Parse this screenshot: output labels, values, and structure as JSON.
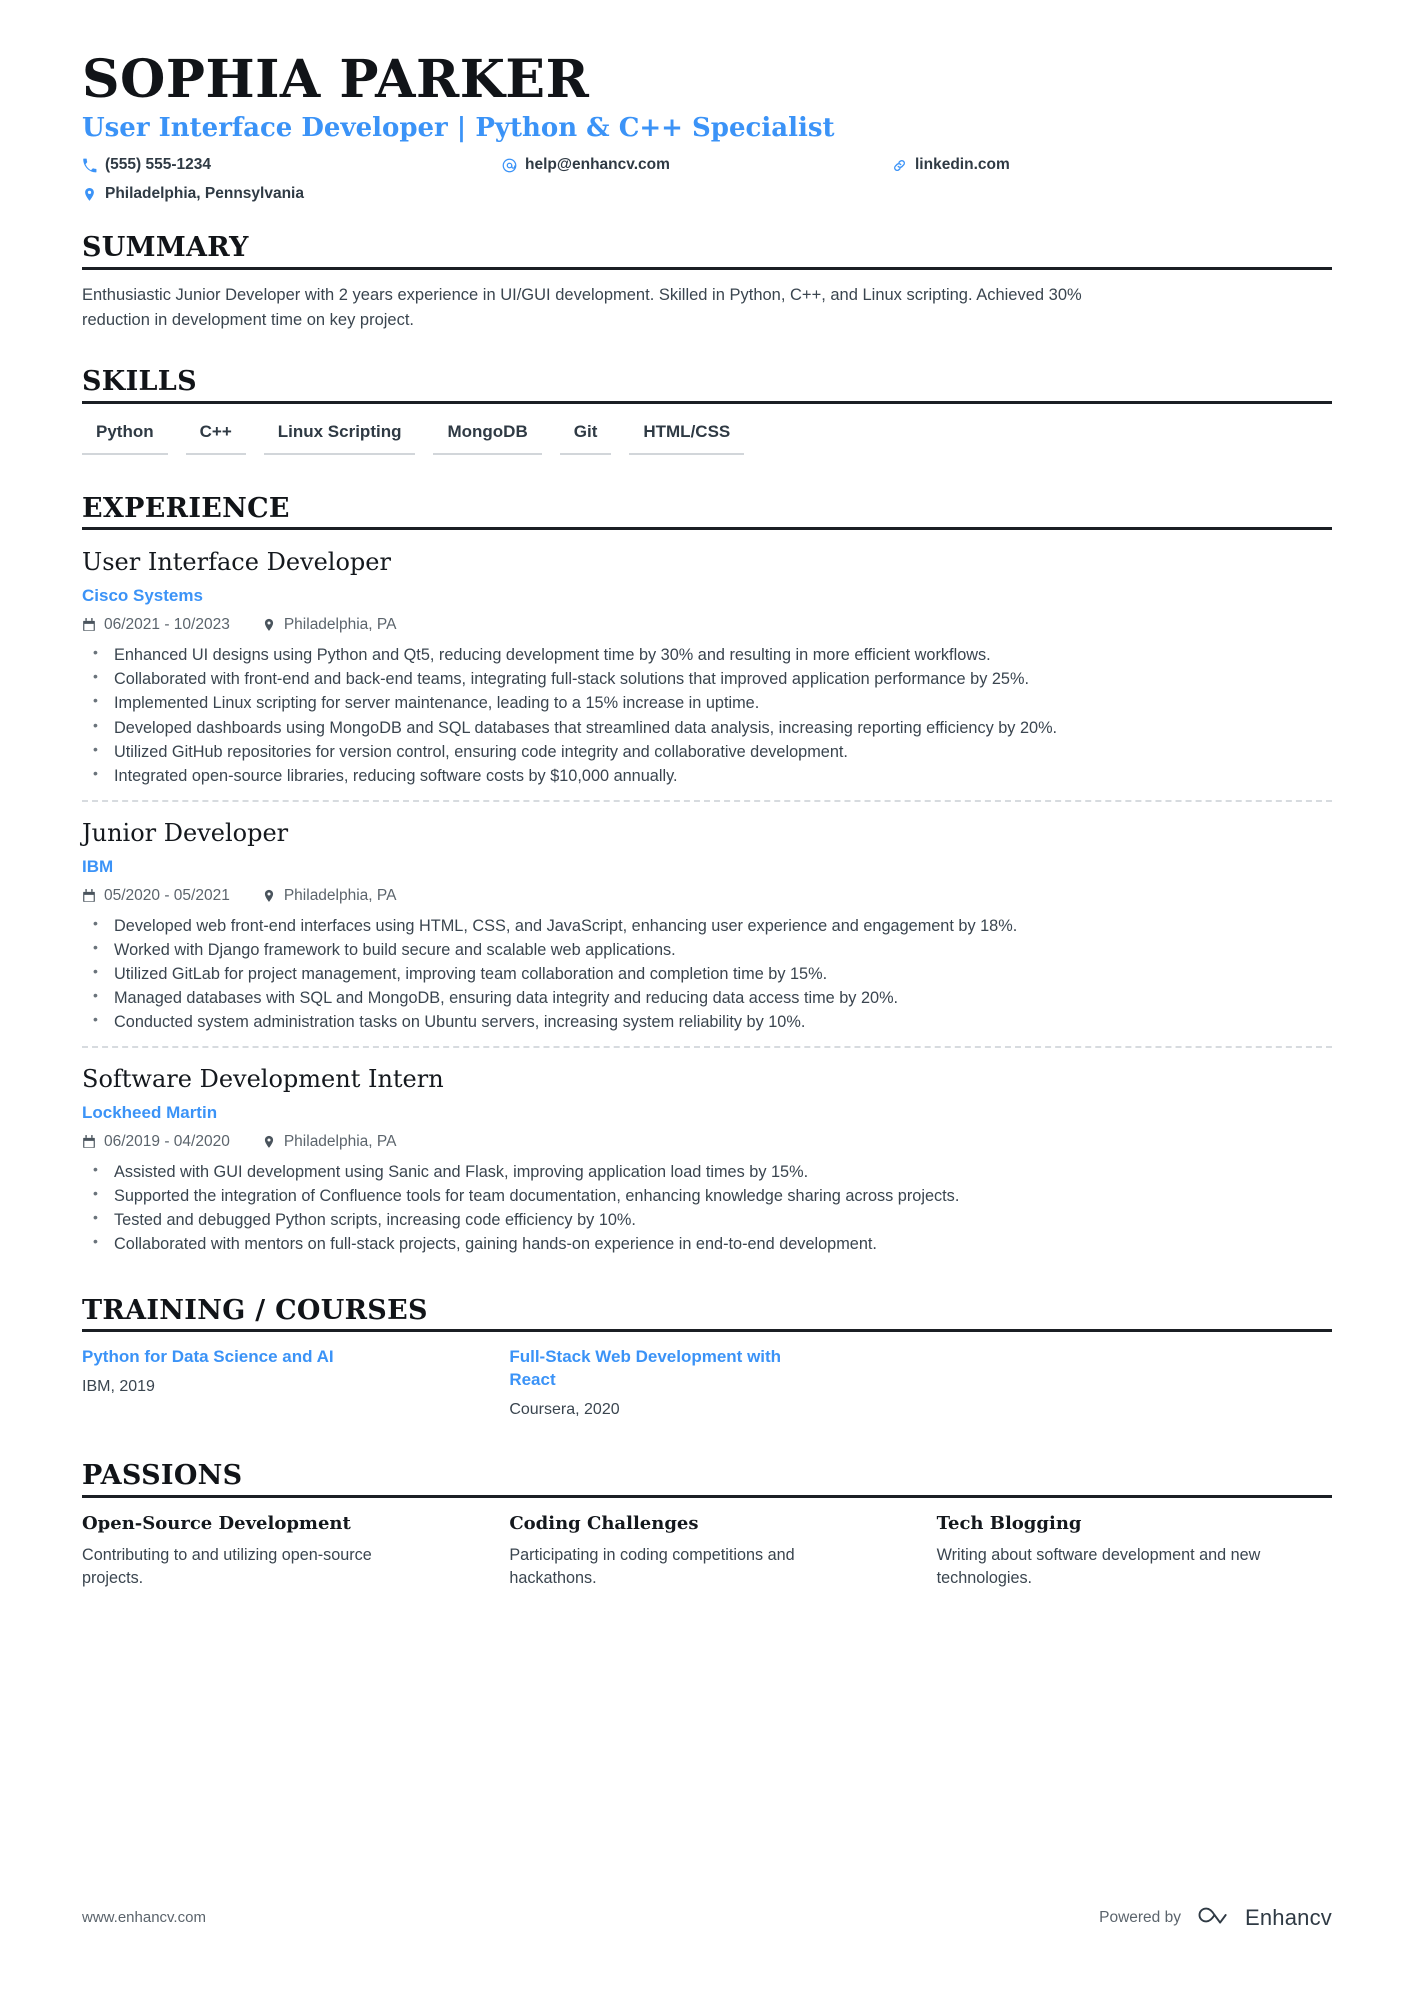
{
  "header": {
    "full_name": "SOPHIA PARKER",
    "job_title": "User Interface Developer | Python & C++ Specialist",
    "contacts": [
      {
        "icon": "phone-icon",
        "text": "(555) 555-1234"
      },
      {
        "icon": "email-icon",
        "text": "help@enhancv.com"
      },
      {
        "icon": "link-icon",
        "text": "linkedin.com"
      },
      {
        "icon": "location-pin-icon",
        "text": "Philadelphia, Pennsylvania"
      }
    ]
  },
  "summary": {
    "heading": "SUMMARY",
    "text": "Enthusiastic Junior Developer with 2 years experience in UI/GUI development. Skilled in Python, C++, and Linux scripting. Achieved 30% reduction in development time on key project."
  },
  "skills": {
    "heading": "SKILLS",
    "items": [
      "Python",
      "C++",
      "Linux Scripting",
      "MongoDB",
      "Git",
      "HTML/CSS"
    ]
  },
  "experience": {
    "heading": "EXPERIENCE",
    "items": [
      {
        "role": "User Interface Developer",
        "company": "Cisco Systems",
        "dates": "06/2021 - 10/2023",
        "location": "Philadelphia, PA",
        "bullets": [
          "Enhanced UI designs using Python and Qt5, reducing development time by 30% and resulting in more efficient workflows.",
          "Collaborated with front-end and back-end teams, integrating full-stack solutions that improved application performance by 25%.",
          "Implemented Linux scripting for server maintenance, leading to a 15% increase in uptime.",
          "Developed dashboards using MongoDB and SQL databases that streamlined data analysis, increasing reporting efficiency by 20%.",
          "Utilized GitHub repositories for version control, ensuring code integrity and collaborative development.",
          "Integrated open-source libraries, reducing software costs by $10,000 annually."
        ]
      },
      {
        "role": "Junior Developer",
        "company": "IBM",
        "dates": "05/2020 - 05/2021",
        "location": "Philadelphia, PA",
        "bullets": [
          "Developed web front-end interfaces using HTML, CSS, and JavaScript, enhancing user experience and engagement by 18%.",
          "Worked with Django framework to build secure and scalable web applications.",
          "Utilized GitLab for project management, improving team collaboration and completion time by 15%.",
          "Managed databases with SQL and MongoDB, ensuring data integrity and reducing data access time by 20%.",
          "Conducted system administration tasks on Ubuntu servers, increasing system reliability by 10%."
        ]
      },
      {
        "role": "Software Development Intern",
        "company": "Lockheed Martin",
        "dates": "06/2019 - 04/2020",
        "location": "Philadelphia, PA",
        "bullets": [
          "Assisted with GUI development using Sanic and Flask, improving application load times by 15%.",
          "Supported the integration of Confluence tools for team documentation, enhancing knowledge sharing across projects.",
          "Tested and debugged Python scripts, increasing code efficiency by 10%.",
          "Collaborated with mentors on full-stack projects, gaining hands-on experience in end-to-end development."
        ]
      }
    ]
  },
  "training": {
    "heading": "TRAINING / COURSES",
    "items": [
      {
        "name": "Python for Data Science and AI",
        "meta": "IBM, 2019"
      },
      {
        "name": "Full-Stack Web Development with React",
        "meta": "Coursera, 2020"
      }
    ]
  },
  "passions": {
    "heading": "PASSIONS",
    "items": [
      {
        "title": "Open-Source Development",
        "desc": "Contributing to and utilizing open-source projects."
      },
      {
        "title": "Coding Challenges",
        "desc": "Participating in coding competitions and hackathons."
      },
      {
        "title": "Tech Blogging",
        "desc": "Writing about software development and new technologies."
      }
    ]
  },
  "footer": {
    "url": "www.enhancv.com",
    "powered_by": "Powered by",
    "brand": "Enhancv"
  },
  "colors": {
    "accent": "#3b93f7",
    "text": "#2f3a44",
    "rule": "#1b1f24"
  }
}
